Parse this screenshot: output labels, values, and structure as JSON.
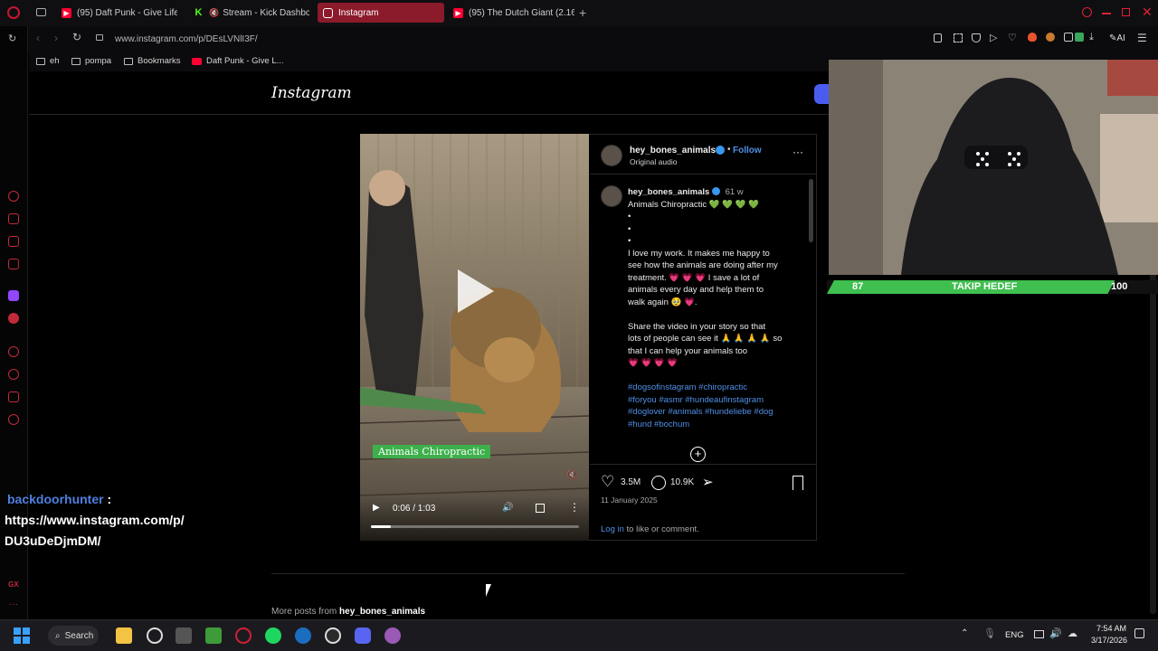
{
  "browser": {
    "tabs": [
      {
        "label": "(95) Daft Punk - Give Life",
        "icon": "youtube-icon",
        "color": "#ff0033"
      },
      {
        "label": "Stream - Kick Dashbo",
        "icon": "kick-icon",
        "color": "#53fc18"
      },
      {
        "label": "Instagram",
        "icon": "instagram-icon",
        "color": "#e1306c",
        "active": true
      },
      {
        "label": "(95) The Dutch Giant (2.16",
        "icon": "youtube-icon",
        "color": "#ff0033"
      }
    ],
    "url": "www.instagram.com/p/DEsLVNlI3F/",
    "bookmarks": [
      "eh",
      "pompa",
      "Bookmarks",
      "Daft Punk - Give L..."
    ],
    "ai_label": "AI"
  },
  "instagram": {
    "logo": "Instagram",
    "post": {
      "username": "hey_bones_animals",
      "follow_label": "Follow",
      "audio": "Original audio",
      "time_ago": "61 w",
      "caption_title": "Animals Chiropractic 💚 💚 💚 💚",
      "caption_dots": [
        "•",
        "•",
        "•"
      ],
      "caption_lines_1": [
        "I love my work. It makes me happy to",
        "see how the animals are doing after my",
        "treatment. 💗 💗 💗 I save a lot of",
        "animals every day and help them to",
        "walk again 🥹 💗."
      ],
      "caption_lines_2": [
        "Share the video in your story so that",
        "lots of people can see it 🙏 🙏 🙏 🙏 so",
        "that I can help your animals too",
        "💗 💗 💗 💗"
      ],
      "hashtag_lines": [
        "#dogsofinstagram #chiropractic",
        "#foryou #asmr #hundeaufinstagram",
        "#doglover #animals #hundeliebe #dog",
        "#hund #bochum"
      ],
      "likes": "3.5M",
      "comments": "10.9K",
      "date": "11 January 2025",
      "login_link": "Log in",
      "login_rest": " to like or comment.",
      "video_overlay_text": "Animals Chiropractic",
      "video_time": "0:06 / 1:03",
      "video_progress": 0.095,
      "more_posts_prefix": "More posts from ",
      "more_posts_user": "hey_bones_animals"
    }
  },
  "chat": {
    "user": "backdoorhunter",
    "separator": " :",
    "message_lines": [
      "https://www.instagram.com/p/",
      "DU3uDeDjmDM/"
    ]
  },
  "stream_overlay": {
    "follow_current": "87",
    "follow_title": "TAKIP HEDEF",
    "follow_target": "100",
    "follow_progress": 0.87
  },
  "taskbar": {
    "search_label": "Search",
    "lang": "ENG",
    "time": "7:54 AM",
    "date": "3/17/2026"
  }
}
